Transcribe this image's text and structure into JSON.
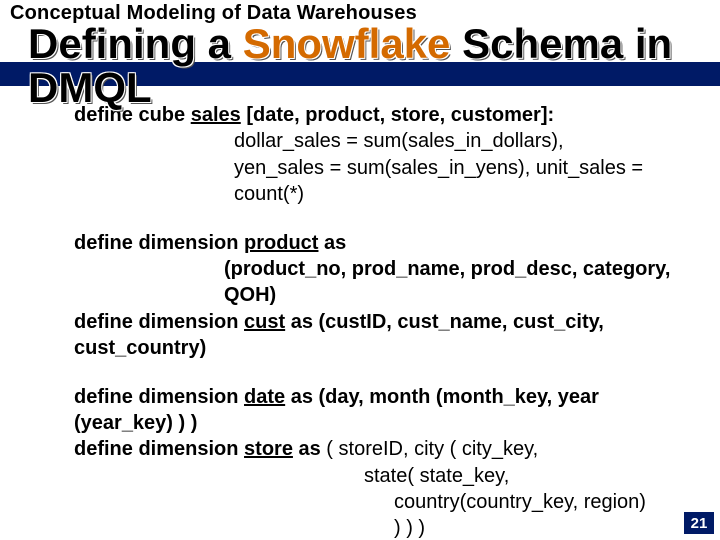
{
  "header": {
    "kicker": "Conceptual Modeling of Data Warehouses",
    "title_prefix": "Defining a ",
    "title_highlight": "Snowflake",
    "title_suffix": " Schema in DMQL"
  },
  "body": {
    "l1_pre": "define cube ",
    "l1_u": "sales",
    "l1_post": " [date, product, store, customer]:",
    "l2": "dollar_sales = sum(sales_in_dollars),",
    "l3": "yen_sales = sum(sales_in_yens), unit_sales = count(*)",
    "l4_pre": "define dimension ",
    "l4_u": "product",
    "l4_post": " as",
    "l5": "(product_no, prod_name, prod_desc, category, QOH)",
    "l6_pre": "define dimension ",
    "l6_u": "cust",
    "l6_post": " as (custID, cust_name, cust_city, cust_country)",
    "l7_pre": "define dimension ",
    "l7_u": "date",
    "l7_post": " as (day, month (month_key, year (year_key) ) )",
    "l8_pre": "define dimension ",
    "l8_u": "store",
    "l8_post": " as ",
    "l8_tail": "( storeID, city ( city_key,",
    "l9": "state( state_key,",
    "l10": "country(country_key, region)",
    "l11": ") ) )"
  },
  "page_number": "21"
}
